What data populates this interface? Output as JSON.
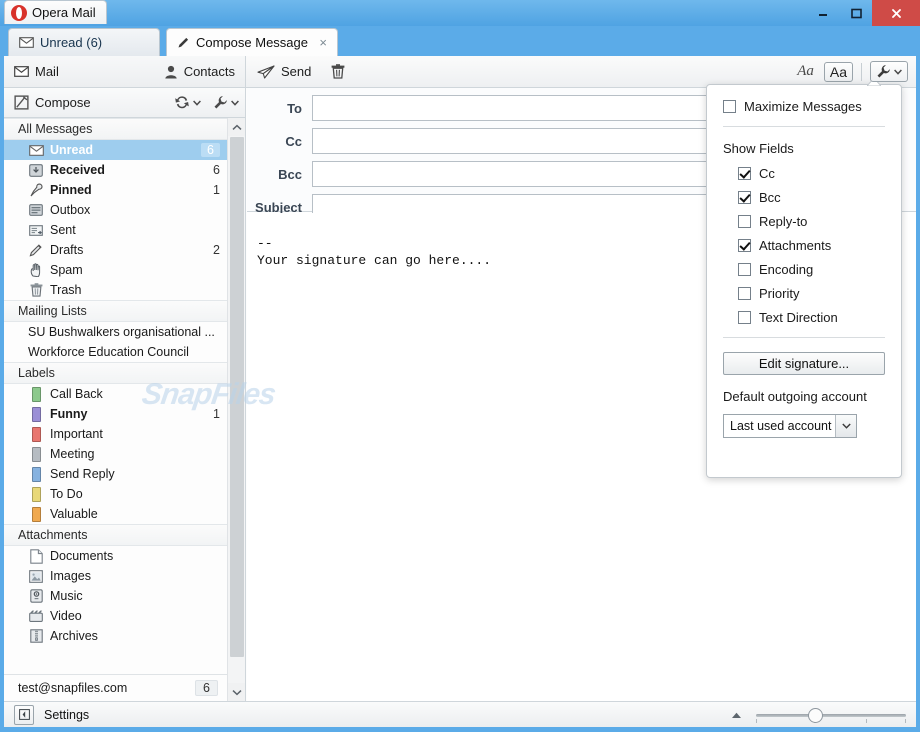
{
  "window": {
    "app_title": "Opera Mail",
    "controls": {
      "minimize": "minimize-icon",
      "maximize": "maximize-icon",
      "close": "close-icon"
    }
  },
  "tabs": [
    {
      "label": "Unread (6)",
      "icon": "envelope-icon",
      "active": false,
      "closable": false
    },
    {
      "label": "Compose Message",
      "icon": "pencil-icon",
      "active": true,
      "closable": true,
      "close_label": "×"
    }
  ],
  "new_tab_button": {
    "icon": "new-compose-icon"
  },
  "toolbar": {
    "mail_label": "Mail",
    "contacts_label": "Contacts",
    "send_label": "Send",
    "discard_label": "",
    "font_plain_label": "Aa",
    "font_boxed_label": "Aa",
    "wrench_label": ""
  },
  "row2": {
    "compose_label": "Compose"
  },
  "sidebar": {
    "groups": [
      {
        "title": "All Messages",
        "items": [
          {
            "label": "Unread",
            "icon": "envelope-icon",
            "count": "6",
            "selected": true,
            "bold": true
          },
          {
            "label": "Received",
            "icon": "inbox-icon",
            "count": "6",
            "selected": false,
            "bold": true
          },
          {
            "label": "Pinned",
            "icon": "pin-icon",
            "count": "1",
            "selected": false,
            "bold": true
          },
          {
            "label": "Outbox",
            "icon": "outbox-icon",
            "count": "",
            "selected": false,
            "bold": false
          },
          {
            "label": "Sent",
            "icon": "sent-icon",
            "count": "",
            "selected": false,
            "bold": false
          },
          {
            "label": "Drafts",
            "icon": "pencil-icon",
            "count": "2",
            "selected": false,
            "bold": false
          },
          {
            "label": "Spam",
            "icon": "hand-icon",
            "count": "",
            "selected": false,
            "bold": false
          },
          {
            "label": "Trash",
            "icon": "trash-icon",
            "count": "",
            "selected": false,
            "bold": false
          }
        ]
      },
      {
        "title": "Mailing Lists",
        "items": [
          {
            "label": "SU Bushwalkers organisational ...",
            "icon": "",
            "count": "",
            "selected": false,
            "bold": false
          },
          {
            "label": "Workforce Education Council",
            "icon": "",
            "count": "",
            "selected": false,
            "bold": false
          }
        ]
      },
      {
        "title": "Labels",
        "items": [
          {
            "label": "Call Back",
            "icon": "label-chip",
            "color": "#8cc98c",
            "count": "",
            "selected": false,
            "bold": false
          },
          {
            "label": "Funny",
            "icon": "label-chip",
            "color": "#9b8fd6",
            "count": "1",
            "selected": false,
            "bold": true
          },
          {
            "label": "Important",
            "icon": "label-chip",
            "color": "#e8766f",
            "count": "",
            "selected": false,
            "bold": false
          },
          {
            "label": "Meeting",
            "icon": "label-chip",
            "color": "#b6bcc2",
            "count": "",
            "selected": false,
            "bold": false
          },
          {
            "label": "Send Reply",
            "icon": "label-chip",
            "color": "#86b2e0",
            "count": "",
            "selected": false,
            "bold": false
          },
          {
            "label": "To Do",
            "icon": "label-chip",
            "color": "#e8d878",
            "count": "",
            "selected": false,
            "bold": false
          },
          {
            "label": "Valuable",
            "icon": "label-chip",
            "color": "#f0a94f",
            "count": "",
            "selected": false,
            "bold": false
          }
        ]
      },
      {
        "title": "Attachments",
        "items": [
          {
            "label": "Documents",
            "icon": "document-icon",
            "count": "",
            "selected": false,
            "bold": false
          },
          {
            "label": "Images",
            "icon": "image-icon",
            "count": "",
            "selected": false,
            "bold": false
          },
          {
            "label": "Music",
            "icon": "music-icon",
            "count": "",
            "selected": false,
            "bold": false
          },
          {
            "label": "Video",
            "icon": "video-icon",
            "count": "",
            "selected": false,
            "bold": false
          },
          {
            "label": "Archives",
            "icon": "archive-icon",
            "count": "",
            "selected": false,
            "bold": false
          }
        ]
      }
    ],
    "account": {
      "label": "test@snapfiles.com",
      "count": "6"
    }
  },
  "compose": {
    "fields": [
      {
        "label": "To",
        "value": "",
        "placeholder": ""
      },
      {
        "label": "Cc",
        "value": "",
        "placeholder": ""
      },
      {
        "label": "Bcc",
        "value": "",
        "placeholder": ""
      },
      {
        "label": "Subject",
        "value": "",
        "placeholder": ""
      }
    ],
    "body": "--\nYour signature can go here...."
  },
  "watermark": {
    "text": "SnapFiles"
  },
  "panel": {
    "maximize_messages": {
      "label": "Maximize Messages",
      "checked": false
    },
    "show_fields_title": "Show Fields",
    "fields": [
      {
        "label": "Cc",
        "checked": true
      },
      {
        "label": "Bcc",
        "checked": true
      },
      {
        "label": "Reply-to",
        "checked": false
      },
      {
        "label": "Attachments",
        "checked": true
      },
      {
        "label": "Encoding",
        "checked": false
      },
      {
        "label": "Priority",
        "checked": false
      },
      {
        "label": "Text Direction",
        "checked": false
      }
    ],
    "edit_signature_label": "Edit signature...",
    "default_account_title": "Default outgoing account",
    "default_account_value": "Last used account"
  },
  "statusbar": {
    "settings_label": "Settings",
    "zoom_percent": 38
  },
  "colors": {
    "window_frame": "#5babe8",
    "selection": "#9ecdee",
    "close_button": "#cf4b47",
    "opera_red": "#d8322a"
  }
}
